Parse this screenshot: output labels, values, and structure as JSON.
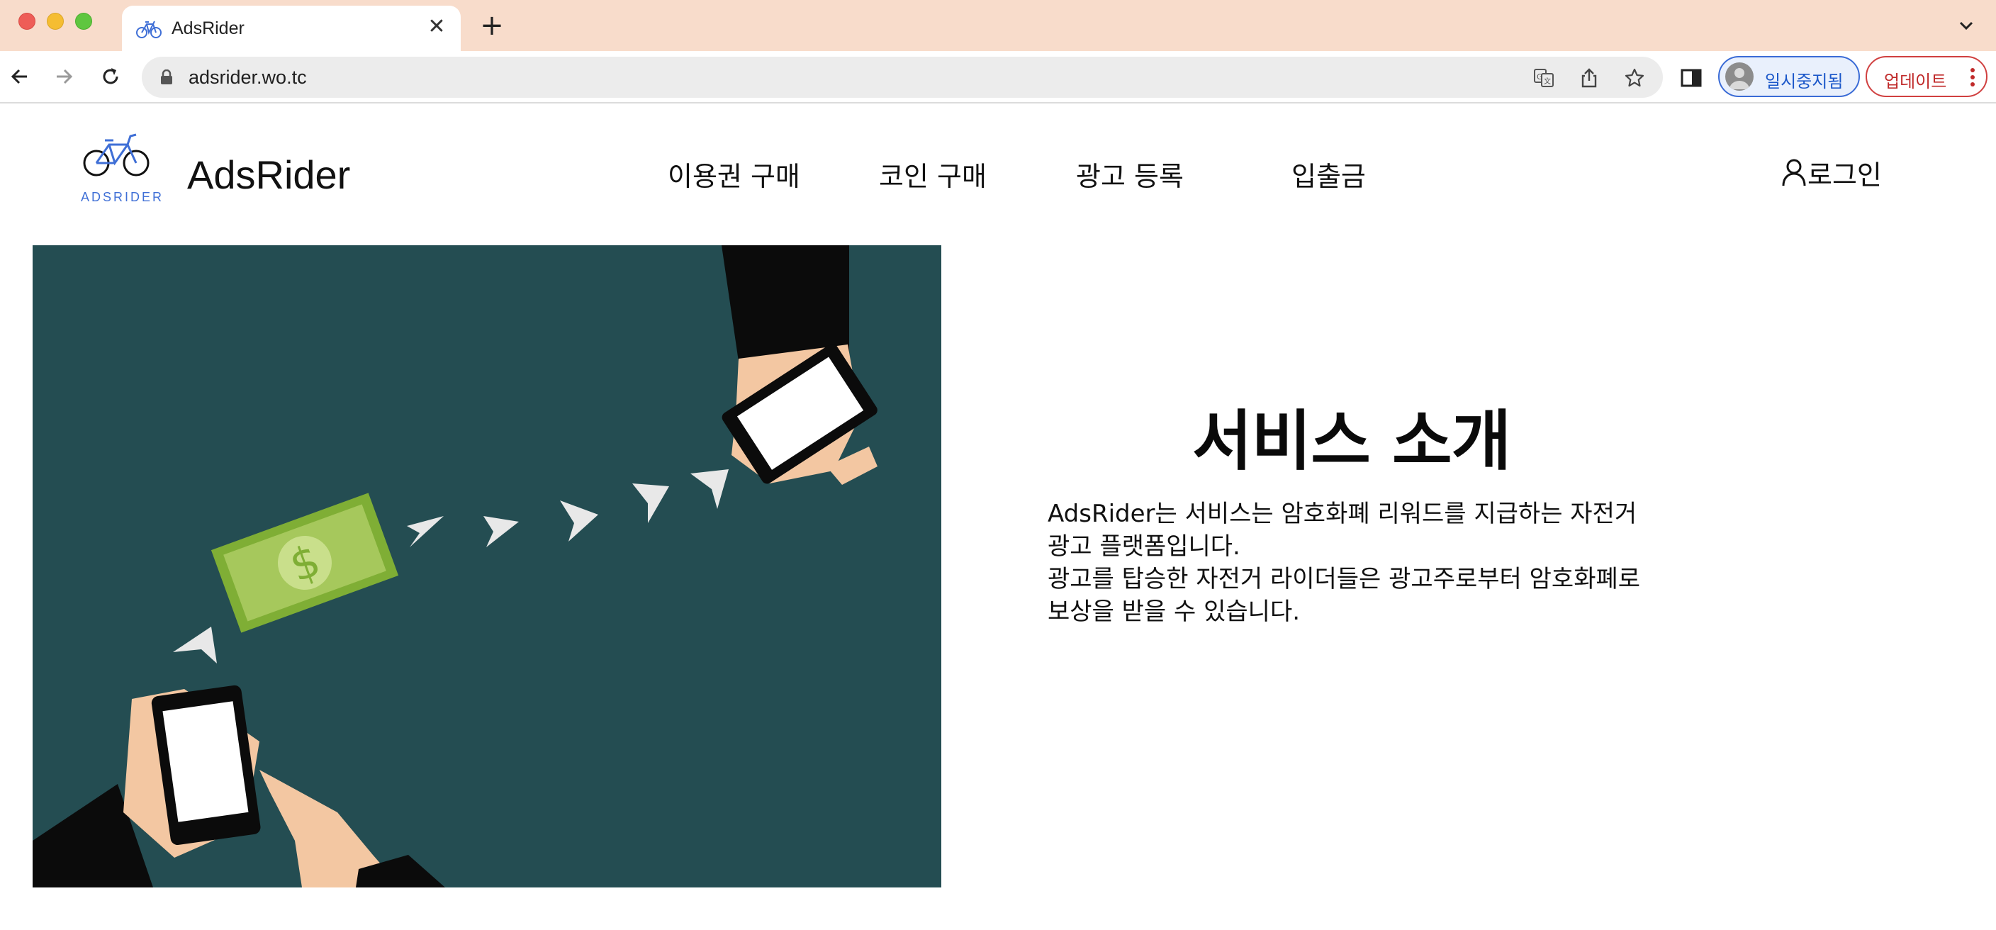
{
  "browser": {
    "tab_title": "AdsRider",
    "url": "adsrider.wo.tc",
    "profile_label": "일시중지됨",
    "update_label": "업데이트"
  },
  "site": {
    "logo_caption": "ADSRIDER",
    "brand": "AdsRider",
    "nav": [
      {
        "label": "이용권 구매"
      },
      {
        "label": "코인 구매"
      },
      {
        "label": "광고 등록"
      },
      {
        "label": "입출금"
      }
    ],
    "login_label": "로그인"
  },
  "intro": {
    "title": "서비스 소개",
    "lines": [
      "AdsRider는 서비스는 암호화폐 리워드를 지급하는 자전거",
      "광고 플랫폼입니다.",
      "광고를 탑승한 자전거 라이더들은 광고주로부터 암호화폐로",
      "보상을 받을 수 있습니다."
    ]
  },
  "colors": {
    "tabstrip": "#f8dccb",
    "hero_background": "#244d52",
    "accent_blue": "#3f6fd6",
    "update_red": "#c02a2a",
    "banknote": "#7fae35"
  },
  "icons": [
    "bicycle-icon",
    "close-icon",
    "plus-icon",
    "chevron-down-icon",
    "back-icon",
    "forward-icon",
    "reload-icon",
    "lock-icon",
    "translate-icon",
    "share-icon",
    "star-icon",
    "side-panel-icon",
    "person-icon",
    "kebab-icon"
  ]
}
